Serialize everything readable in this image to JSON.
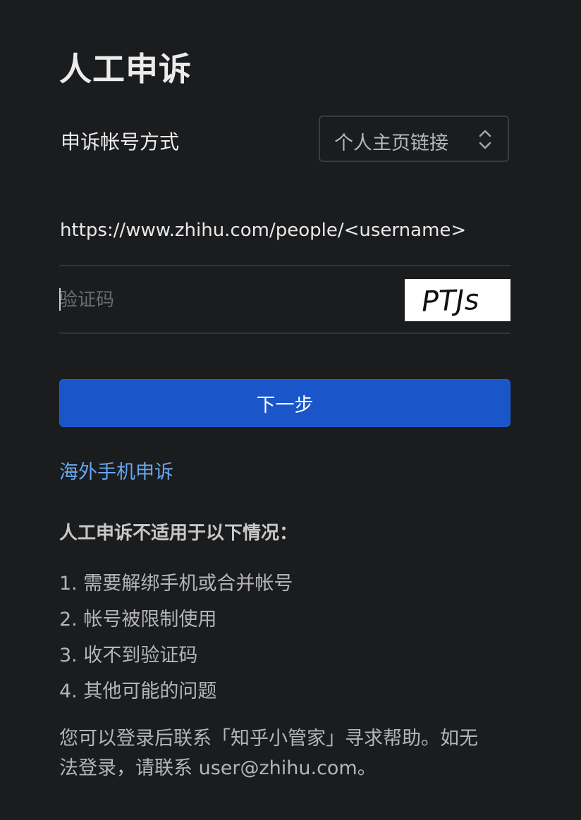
{
  "title": "人工申诉",
  "method": {
    "label": "申诉帐号方式",
    "selected": "个人主页链接"
  },
  "url_field": {
    "value": "https://www.zhihu.com/people/<username>"
  },
  "captcha": {
    "placeholder": "验证码",
    "code": "PTJs"
  },
  "next_button": {
    "label": "下一步"
  },
  "overseas_link": {
    "label": "海外手机申诉"
  },
  "notice": {
    "heading": "人工申诉不适用于以下情况：",
    "items": [
      "1. 需要解绑手机或合并帐号",
      "2. 帐号被限制使用",
      "3. 收不到验证码",
      "4. 其他可能的问题"
    ]
  },
  "footer": {
    "line1": "您可以登录后联系「知乎小管家」寻求帮助。如无",
    "line2": "法登录，请联系 user@zhihu.com。"
  },
  "colors": {
    "background": "#1b1c1e",
    "primary_button": "#1a56c9",
    "link": "#67a7ee"
  },
  "icons": {
    "select_arrows": "chevron-up-down-icon"
  }
}
